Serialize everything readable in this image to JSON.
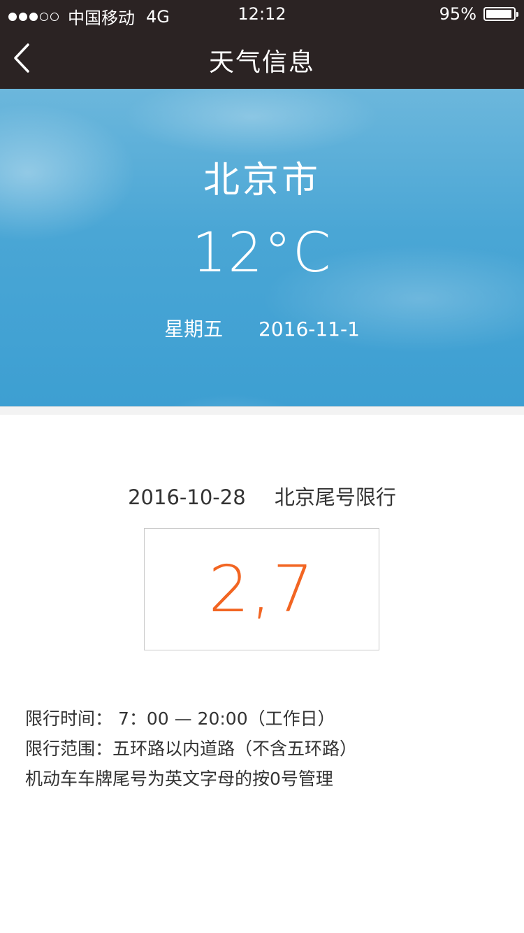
{
  "status_bar": {
    "signal_filled": 3,
    "signal_empty": 2,
    "carrier": "中国移动",
    "network": "4G",
    "time": "12:12",
    "battery_percent_text": "95%",
    "battery_level": 0.95
  },
  "nav": {
    "back_icon": "chevron-left-icon",
    "title": "天气信息"
  },
  "weather": {
    "city": "北京市",
    "temperature": "12°C",
    "weekday": "星期五",
    "date": "2016-11-1"
  },
  "restriction": {
    "date": "2016-10-28",
    "title": "北京尾号限行",
    "numbers": "2,7",
    "number_color": "#f26522",
    "lines": [
      "限行时间：  7：00 — 20:00（工作日）",
      "限行范围：五环路以内道路（不含五环路）",
      "机动车车牌尾号为英文字母的按0号管理"
    ]
  },
  "colors": {
    "header_bg": "#2b2323",
    "sky_blue": "#4aa6d5",
    "accent_orange": "#f26522"
  }
}
